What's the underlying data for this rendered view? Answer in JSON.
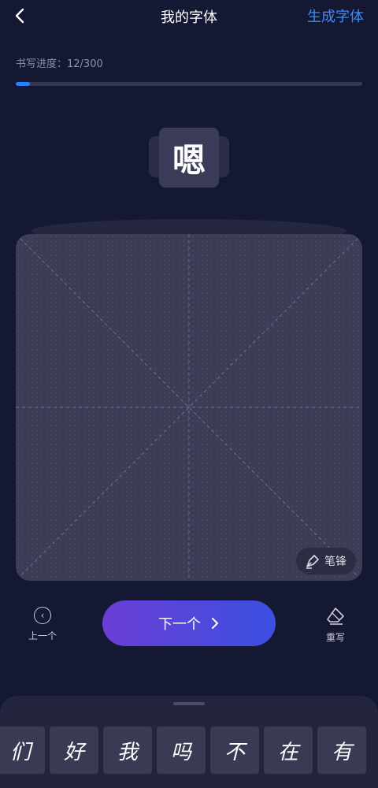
{
  "header": {
    "title": "我的字体",
    "generate_label": "生成字体"
  },
  "progress": {
    "label": "书写进度：12/300",
    "current": 12,
    "total": 300
  },
  "current_char": "嗯",
  "canvas": {
    "pen_label": "笔锋"
  },
  "actions": {
    "prev_label": "上一个",
    "next_label": "下一个",
    "rewrite_label": "重写"
  },
  "written_chars": [
    "们",
    "好",
    "我",
    "吗",
    "不",
    "在",
    "有"
  ],
  "colors": {
    "background": "#141832",
    "accent": "#3b8bff",
    "progress_fill": "#2e7dff",
    "button_gradient_start": "#6a3fd6",
    "button_gradient_end": "#3c4fe0"
  }
}
